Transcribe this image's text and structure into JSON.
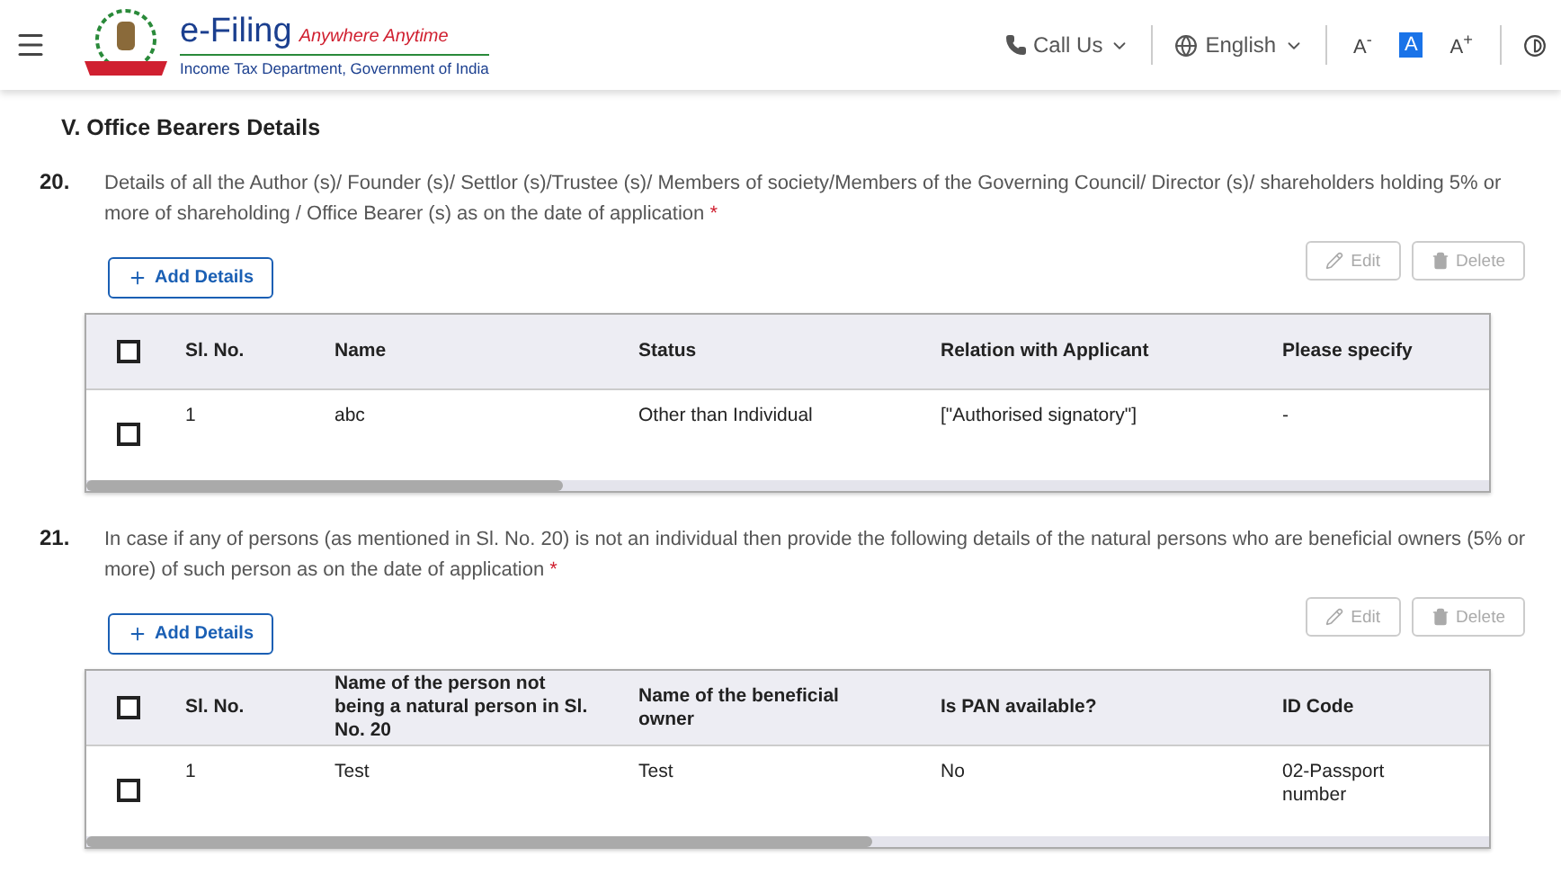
{
  "header": {
    "brand": "e-Filing",
    "tagline": "Anywhere Anytime",
    "subtitle": "Income Tax Department, Government of India",
    "call_us": "Call Us",
    "language": "English",
    "font_sizes": [
      {
        "label": "A",
        "sup": "-",
        "selected": false
      },
      {
        "label": "A",
        "selected": true
      },
      {
        "label": "A",
        "sup": "+",
        "selected": false
      }
    ]
  },
  "section_title": "V. Office Bearers Details",
  "questions": [
    {
      "number": "20.",
      "text": "Details of all the Author (s)/ Founder (s)/ Settlor (s)/Trustee (s)/ Members of society/Members of the Governing Council/ Director (s)/ shareholders holding 5% or more of shareholding / Office Bearer (s) as on the date of application",
      "required_mark": "*",
      "add_button": "Add Details",
      "actions": [
        {
          "kind": "edit",
          "label": "Edit",
          "disabled": true
        },
        {
          "kind": "delete",
          "label": "Delete",
          "disabled": true
        }
      ],
      "table": {
        "header_checked": false,
        "columns": [
          "Sl. No.",
          "Name",
          "Status",
          "Relation with Applicant",
          "Please specify"
        ],
        "rows": [
          {
            "checked": false,
            "cells": [
              "1",
              "abc",
              "Other than Individual",
              "[\"Authorised signatory\"]",
              "-"
            ]
          }
        ]
      }
    },
    {
      "number": "21.",
      "text": "In case if any of persons (as mentioned in Sl. No. 20) is not an individual then provide the following details of the natural persons who are beneficial owners (5% or more) of such person as on the date of application",
      "required_mark": "*",
      "add_button": "Add Details",
      "actions": [
        {
          "kind": "edit",
          "label": "Edit",
          "disabled": true
        },
        {
          "kind": "delete",
          "label": "Delete",
          "disabled": true
        }
      ],
      "table": {
        "header_checked": false,
        "columns": [
          "Sl. No.",
          "Name of the person not being a natural person in Sl. No. 20",
          "Name of the beneficial owner",
          "Is PAN available?",
          "ID Code"
        ],
        "rows": [
          {
            "checked": false,
            "cells": [
              "1",
              "Test",
              "Test",
              "No",
              "02-Passport number"
            ]
          }
        ]
      }
    }
  ]
}
